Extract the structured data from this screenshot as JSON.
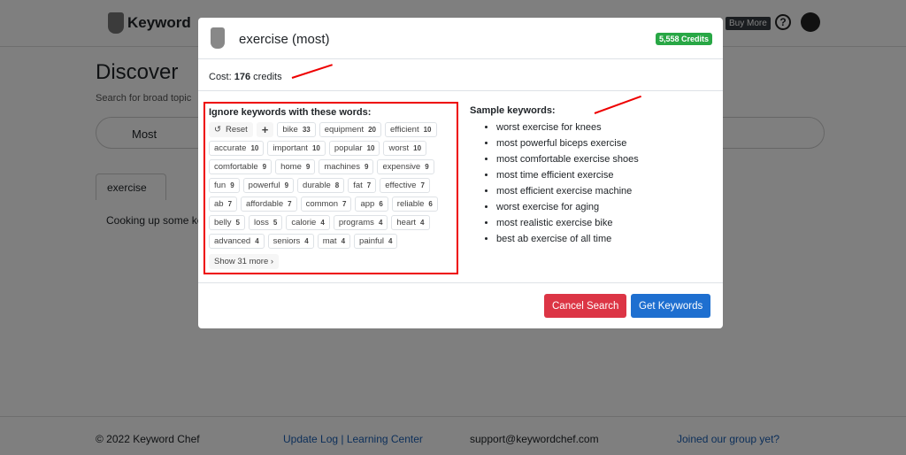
{
  "header": {
    "brand": "Keyword",
    "buy_more": "Buy More",
    "help": "?"
  },
  "page": {
    "title": "Discover",
    "subtitle": "Search for broad topic",
    "search_mode": "Most",
    "tab": "exercise",
    "status": "Cooking up some ke"
  },
  "footer": {
    "copyright": "© 2022 Keyword Chef",
    "links": "Update Log | Learning Center",
    "email": "support@keywordchef.com",
    "facebook": "Joined our group yet?"
  },
  "modal": {
    "title": "exercise (most)",
    "credits_badge": "5,558 Credits",
    "cost_label": "Cost:",
    "cost_value": "176",
    "cost_unit": "credits",
    "ignore_title": "Ignore keywords with these words:",
    "reset": "Reset",
    "add": "+",
    "chips": [
      [
        "bike",
        "33"
      ],
      [
        "equipment",
        "20"
      ],
      [
        "efficient",
        "10"
      ],
      [
        "accurate",
        "10"
      ],
      [
        "important",
        "10"
      ],
      [
        "popular",
        "10"
      ],
      [
        "worst",
        "10"
      ],
      [
        "comfortable",
        "9"
      ],
      [
        "home",
        "9"
      ],
      [
        "machines",
        "9"
      ],
      [
        "expensive",
        "9"
      ],
      [
        "fun",
        "9"
      ],
      [
        "powerful",
        "9"
      ],
      [
        "durable",
        "8"
      ],
      [
        "fat",
        "7"
      ],
      [
        "effective",
        "7"
      ],
      [
        "ab",
        "7"
      ],
      [
        "affordable",
        "7"
      ],
      [
        "common",
        "7"
      ],
      [
        "app",
        "6"
      ],
      [
        "reliable",
        "6"
      ],
      [
        "belly",
        "5"
      ],
      [
        "loss",
        "5"
      ],
      [
        "calorie",
        "4"
      ],
      [
        "programs",
        "4"
      ],
      [
        "heart",
        "4"
      ],
      [
        "advanced",
        "4"
      ],
      [
        "seniors",
        "4"
      ],
      [
        "mat",
        "4"
      ],
      [
        "painful",
        "4"
      ]
    ],
    "show_more": "Show 31 more ›",
    "sample_title": "Sample keywords:",
    "samples": [
      "worst exercise for knees",
      "most powerful biceps exercise",
      "most comfortable exercise shoes",
      "most time efficient exercise",
      "most efficient exercise machine",
      "worst exercise for aging",
      "most realistic exercise bike",
      "best ab exercise of all time"
    ],
    "cancel": "Cancel Search",
    "get": "Get Keywords"
  },
  "colors": {
    "accent": "#1e6fd0",
    "danger": "#dc3545",
    "success": "#28a745",
    "annotation": "#ee0000"
  }
}
